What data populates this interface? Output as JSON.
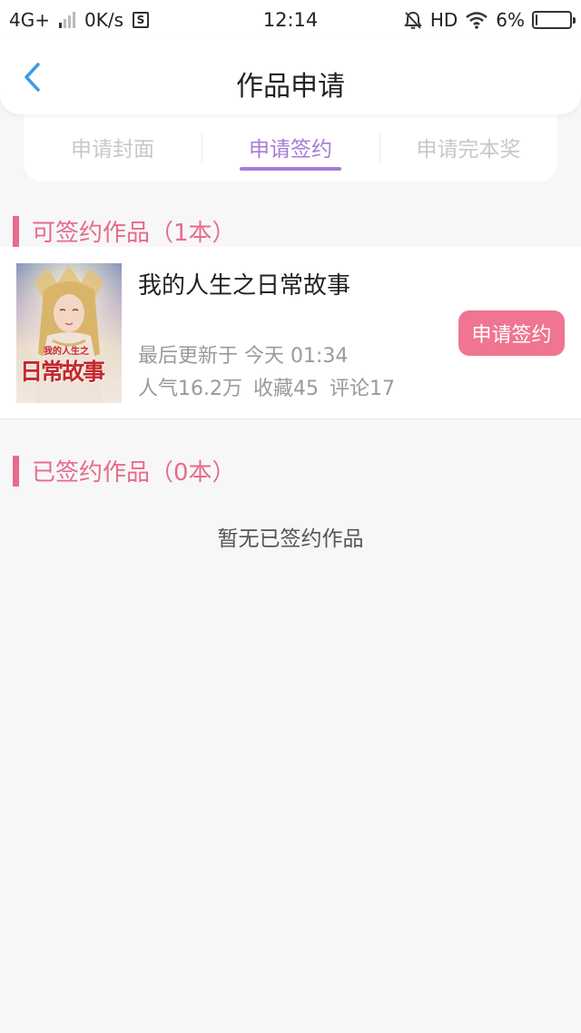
{
  "status_bar": {
    "network": "4G+",
    "speed": "0K/s",
    "s_icon": "S",
    "time": "12:14",
    "hd": "HD",
    "battery": "6%",
    "battery_level": 0.06
  },
  "header": {
    "title": "作品申请"
  },
  "tabs": [
    {
      "label": "申请封面",
      "active": false
    },
    {
      "label": "申请签约",
      "active": true
    },
    {
      "label": "申请完本奖",
      "active": false
    }
  ],
  "signable": {
    "heading": "可签约作品（1本）",
    "books": [
      {
        "title": "我的人生之日常故事",
        "update": "最后更新于 今天 01:34",
        "popularity": "人气16.2万",
        "favorites": "收藏45",
        "comments": "评论17",
        "action_label": "申请签约",
        "cover_title": "日常故事",
        "cover_subtitle": "我的人生之"
      }
    ]
  },
  "signed": {
    "heading": "已签约作品（0本）",
    "empty_text": "暂无已签约作品"
  },
  "colors": {
    "accent_purple": "#a77bd8",
    "accent_pink": "#e86b8b",
    "button_pink": "#ef7590"
  }
}
